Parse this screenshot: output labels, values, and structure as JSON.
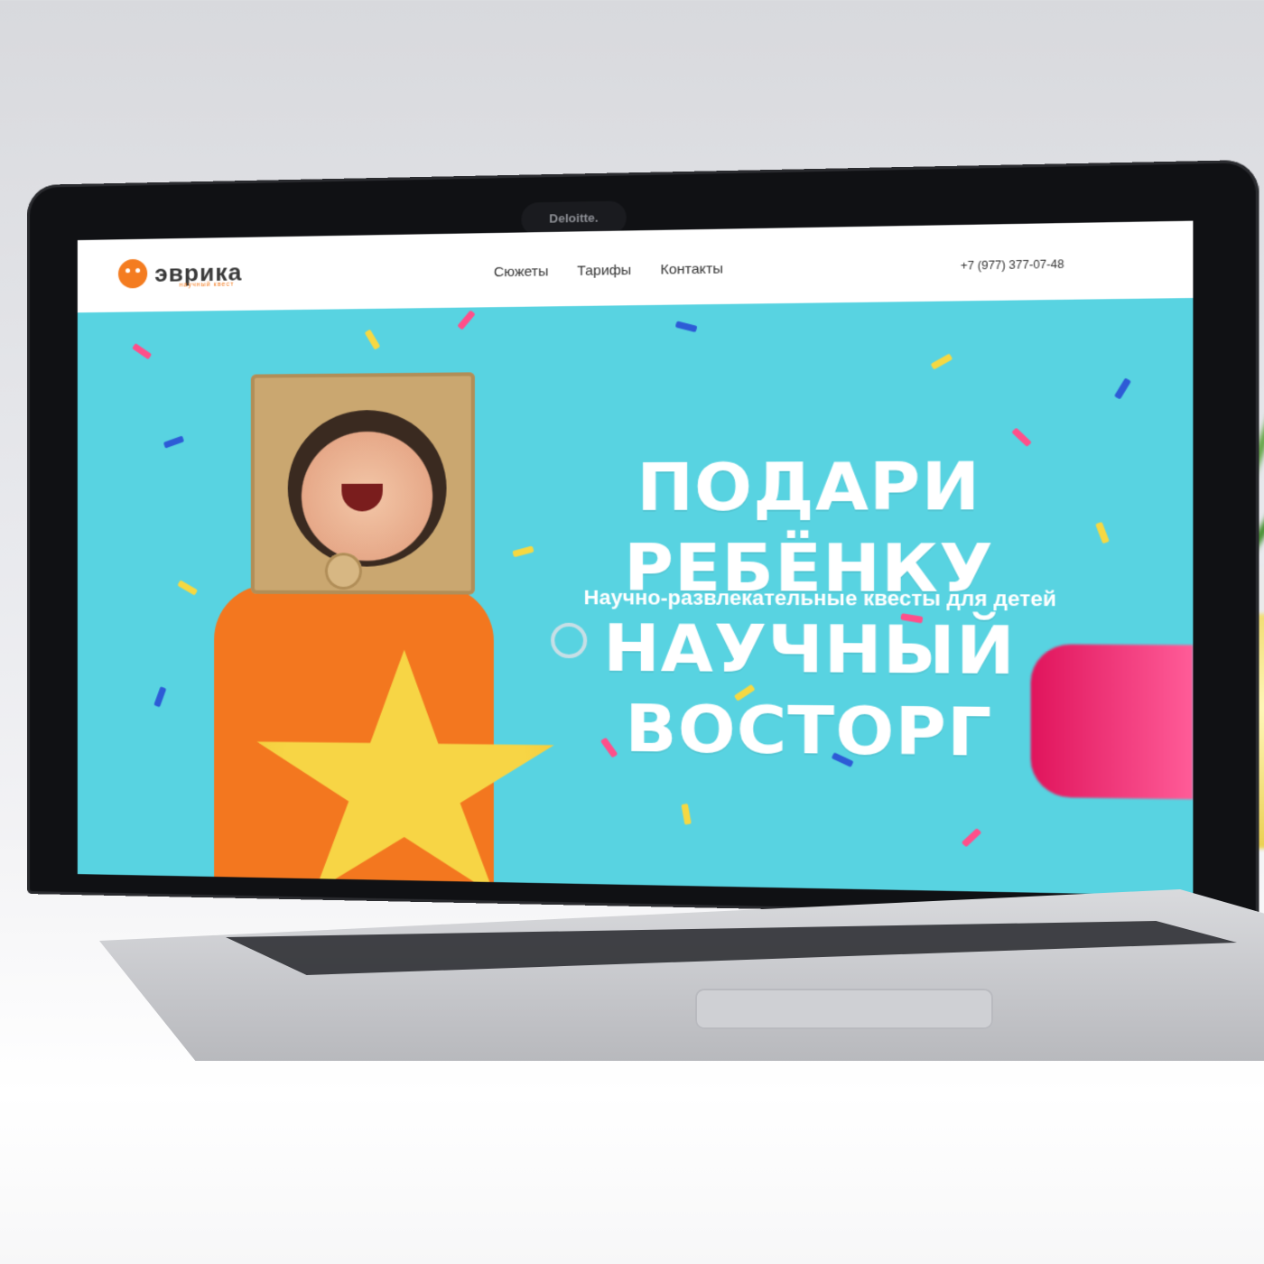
{
  "laptop": {
    "webcam_label": "Deloitte."
  },
  "site": {
    "logo": {
      "name": "эврика",
      "tagline": "научный квест",
      "icon": "robot-head-icon"
    },
    "nav": {
      "items": [
        {
          "label": "Сюжеты"
        },
        {
          "label": "Тарифы"
        },
        {
          "label": "Контакты"
        }
      ]
    },
    "phone": "+7 (977) 377-07-48",
    "hero": {
      "headline_line1": "ПОДАРИ РЕБЁНКУ",
      "headline_line2": "НАУЧНЫЙ ВОСТОРГ",
      "subheadline": "Научно-развлекательные квесты для детей"
    }
  },
  "colors": {
    "hero_bg": "#58d3e1",
    "brand_orange": "#f47c20",
    "header_bg": "#ffffff"
  }
}
